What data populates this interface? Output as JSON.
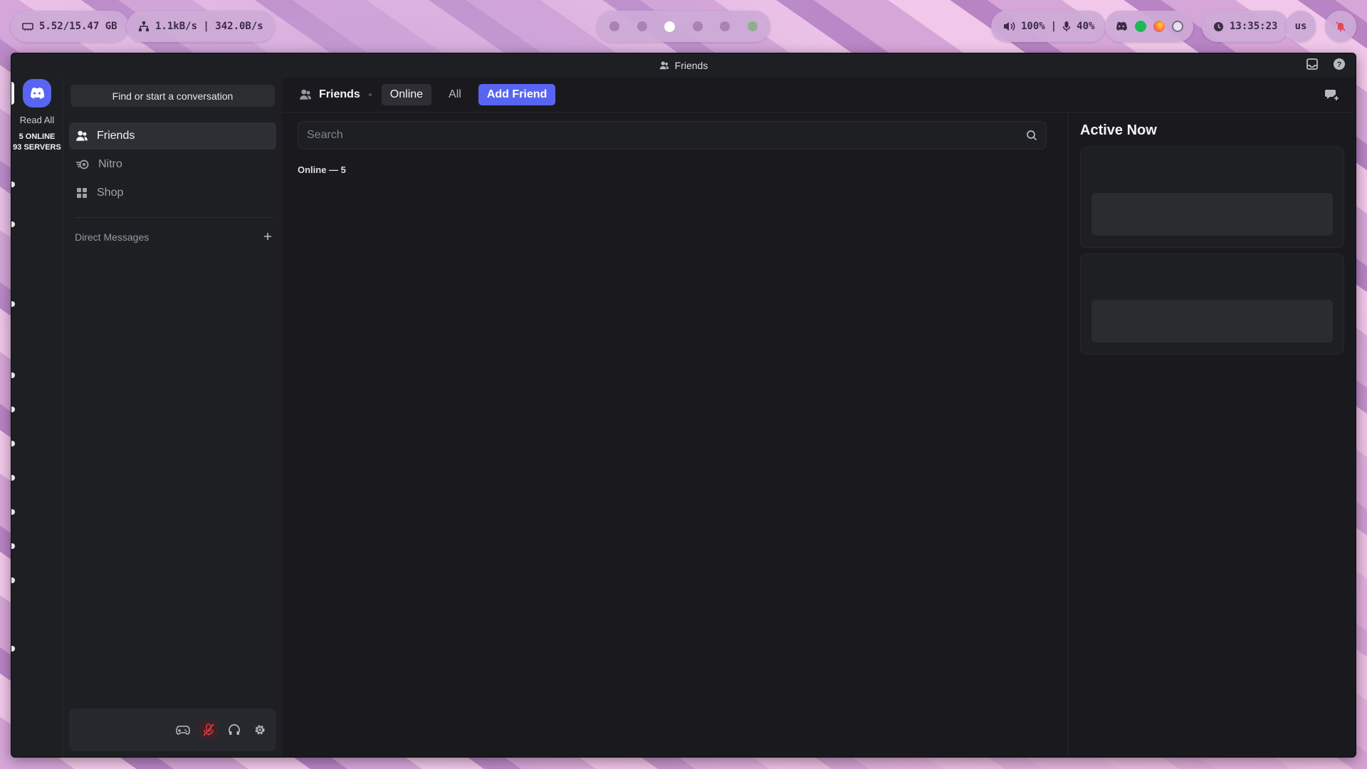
{
  "statusbar": {
    "memory": "5.52/15.47 GB",
    "network": "1.1kB/s | 342.0B/s",
    "workspaces": [
      "1",
      "2",
      "3",
      "4",
      "5",
      "6"
    ],
    "active_workspace": 3,
    "volume": "100%",
    "mic": "40%",
    "tray_icons": [
      "discord-icon",
      "spotify-icon",
      "firefox-icon",
      "steam-icon"
    ],
    "clock": "13:35:23",
    "layout": "us",
    "notifications_icon": "bell-off-icon"
  },
  "window": {
    "title": "Friends"
  },
  "server_rail": {
    "read_all": "Read All",
    "online": "5 ONLINE",
    "servers": "93 SERVERS"
  },
  "sidebar": {
    "find_placeholder": "Find or start a conversation",
    "items": [
      {
        "label": "Friends",
        "icon": "friends-icon",
        "active": true
      },
      {
        "label": "Nitro",
        "icon": "nitro-icon",
        "active": false
      },
      {
        "label": "Shop",
        "icon": "shop-icon",
        "active": false
      }
    ],
    "dm_header": "Direct Messages"
  },
  "main": {
    "header_title": "Friends",
    "tabs": [
      {
        "label": "Online",
        "selected": true
      },
      {
        "label": "All",
        "selected": false
      },
      {
        "label": "Add Friend",
        "selected": false
      }
    ],
    "search_placeholder": "Search",
    "online_count": "Online — 5"
  },
  "active_now": {
    "title": "Active Now"
  },
  "colors": {
    "accent": "#5865f2",
    "background": "#1a1a1e",
    "sidebar": "#1e1f22",
    "muted_red": "#da373c"
  }
}
